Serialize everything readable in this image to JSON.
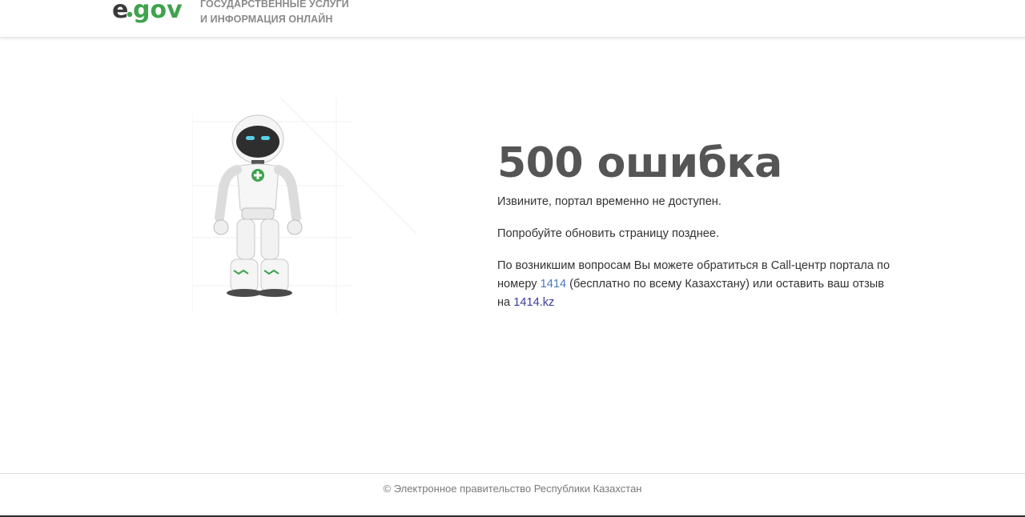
{
  "header": {
    "logo_alt": "e.gov",
    "tagline_line1": "ГОСУДАРСТВЕННЫЕ УСЛУГИ",
    "tagline_line2": "И ИНФОРМАЦИЯ ОНЛАЙН"
  },
  "main": {
    "title": "500 ошибка",
    "message1": "Извините, портал временно не доступен.",
    "message2": "Попробуйте обновить страницу позднее.",
    "message3_part1": "По возникшим вопросам Вы можете обратиться в Call-центр портала по номеру ",
    "phone_link": "1414",
    "message3_part2": " (бесплатно по всему Казахстану) или оставить ваш отзыв на ",
    "site_link": "1414.kz"
  },
  "footer": {
    "copyright": "© Электронное правительство Республики Казахстан"
  },
  "colors": {
    "logo_dark": "#3a3a3a",
    "logo_green": "#3fa34d",
    "title": "#555555",
    "link": "#4a78b8",
    "footer_text": "#7a7a7a"
  },
  "icons": {
    "robot": "robot-illustration-icon"
  }
}
